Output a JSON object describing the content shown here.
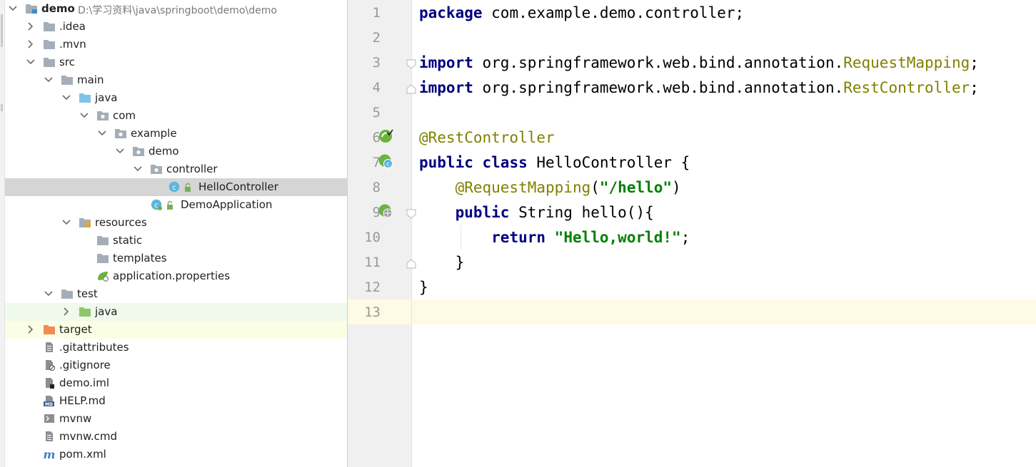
{
  "project_tree": {
    "root": {
      "name": "demo",
      "path": "D:\\学习资料\\java\\springboot\\demo\\demo"
    },
    "items": [
      {
        "label": ".idea"
      },
      {
        "label": ".mvn"
      },
      {
        "label": "src"
      },
      {
        "label": "main"
      },
      {
        "label": "java"
      },
      {
        "label": "com"
      },
      {
        "label": "example"
      },
      {
        "label": "demo"
      },
      {
        "label": "controller"
      },
      {
        "label": "HelloController"
      },
      {
        "label": "DemoApplication"
      },
      {
        "label": "resources"
      },
      {
        "label": "static"
      },
      {
        "label": "templates"
      },
      {
        "label": "application.properties"
      },
      {
        "label": "test"
      },
      {
        "label": "java"
      },
      {
        "label": "target"
      },
      {
        "label": ".gitattributes"
      },
      {
        "label": ".gitignore"
      },
      {
        "label": "demo.iml"
      },
      {
        "label": "HELP.md"
      },
      {
        "label": "mvnw"
      },
      {
        "label": "mvnw.cmd"
      },
      {
        "label": "pom.xml"
      }
    ]
  },
  "editor": {
    "line_numbers": [
      "1",
      "2",
      "3",
      "4",
      "5",
      "6",
      "7",
      "8",
      "9",
      "10",
      "11",
      "12",
      "13"
    ],
    "line1": {
      "kw": "package",
      "rest": " com.example.demo.controller;"
    },
    "line3": {
      "kw": "import",
      "rest": " org.springframework.web.bind.annotation.",
      "cls": "RequestMapping",
      "end": ";"
    },
    "line4": {
      "kw": "import",
      "rest": " org.springframework.web.bind.annotation.",
      "cls": "RestController",
      "end": ";"
    },
    "line6": {
      "ann": "@RestController"
    },
    "line7": {
      "kw1": "public",
      "kw2": "class",
      "rest": " HelloController {"
    },
    "line8": {
      "ann": "@RequestMapping",
      "open": "(",
      "str": "\"/hello\"",
      "close": ")"
    },
    "line9": {
      "kw": "public",
      "rest": " String hello(){"
    },
    "line10": {
      "kw": "return",
      "str": "\"Hello,world!\"",
      "end": ";"
    },
    "line11": {
      "text": "}"
    },
    "line12": {
      "text": "}"
    }
  },
  "colors": {
    "keyword": "#000080",
    "annotation": "#808000",
    "string": "#008000",
    "selection": "#d5d5d5",
    "current_line": "#fffae3"
  }
}
